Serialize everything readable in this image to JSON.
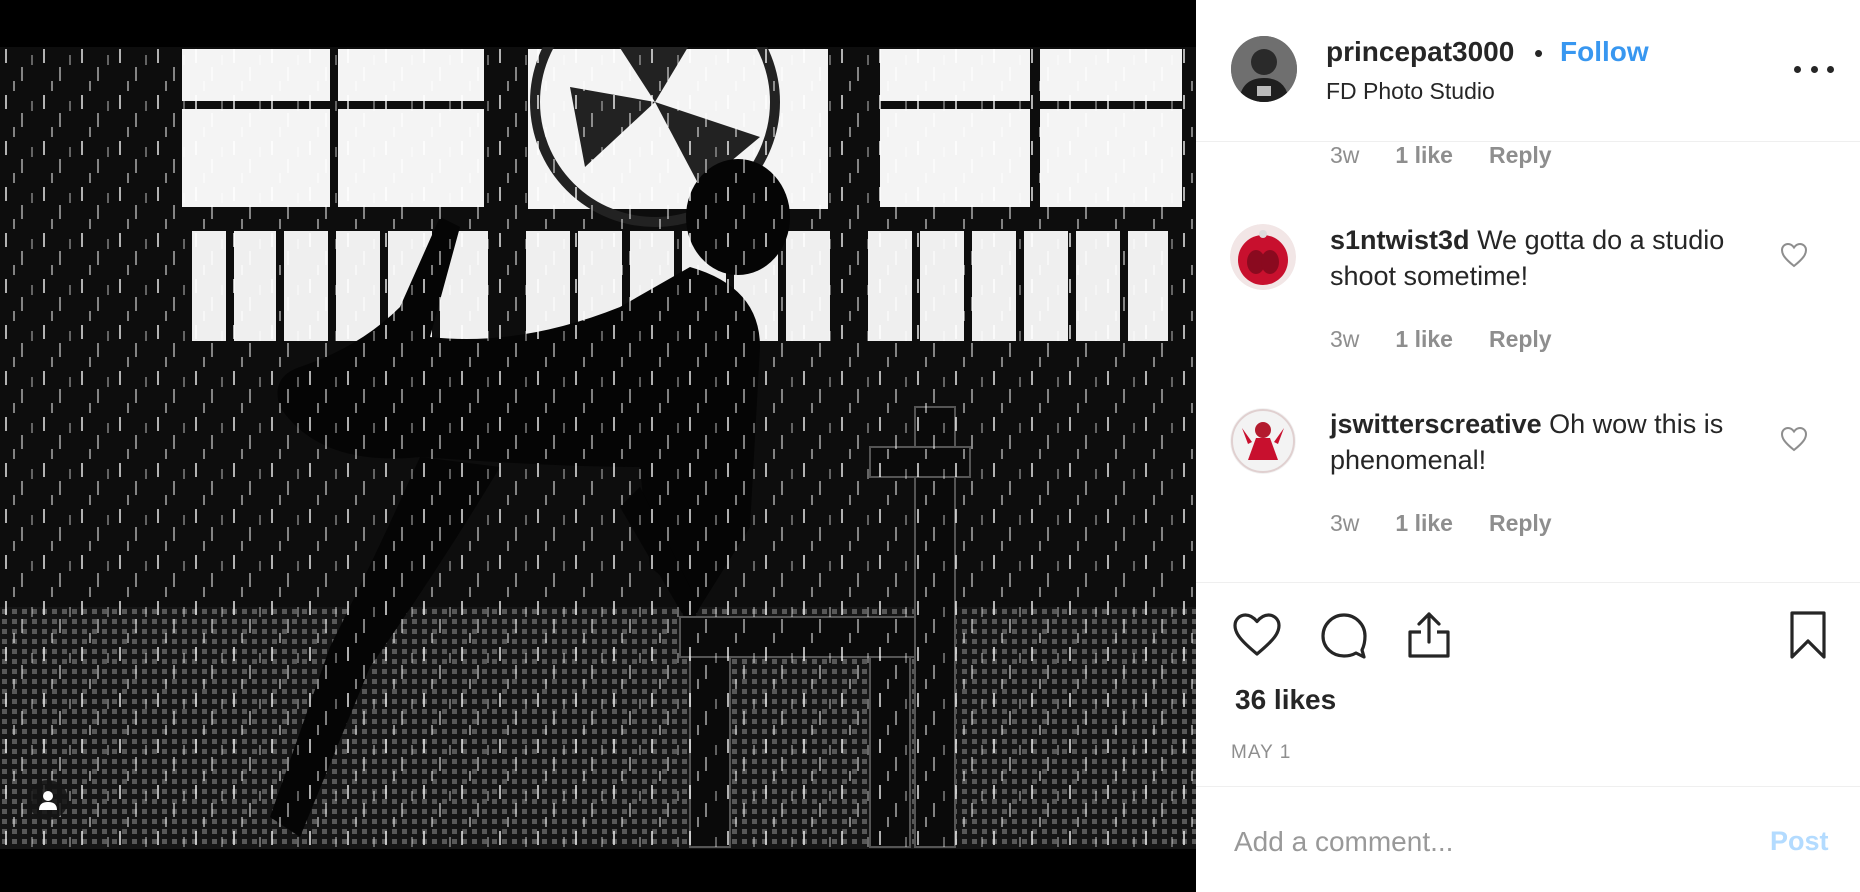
{
  "post": {
    "username": "princepat3000",
    "separator": "•",
    "follow_label": "Follow",
    "location": "FD Photo Studio",
    "more_icon": "more-options-icon"
  },
  "comments": [
    {
      "username": "",
      "text": "",
      "time": "3w",
      "likes": "1 like",
      "reply": "Reply"
    },
    {
      "username": "s1ntwist3d",
      "text": "We gotta do a studio shoot sometime!",
      "time": "3w",
      "likes": "1 like",
      "reply": "Reply"
    },
    {
      "username": "jswitterscreative",
      "text": "Oh wow this is phenomenal!",
      "time": "3w",
      "likes": "1 like",
      "reply": "Reply"
    }
  ],
  "actions": {
    "like_icon": "heart-icon",
    "comment_icon": "comment-icon",
    "share_icon": "share-icon",
    "save_icon": "bookmark-icon"
  },
  "likes_count": "36 likes",
  "date": "MAY 1",
  "add_comment": {
    "placeholder": "Add a comment...",
    "post_label": "Post"
  },
  "colors": {
    "link_blue": "#3897f0",
    "post_disabled": "#b3dbff",
    "muted": "#8e8e8e",
    "text": "#262626"
  }
}
